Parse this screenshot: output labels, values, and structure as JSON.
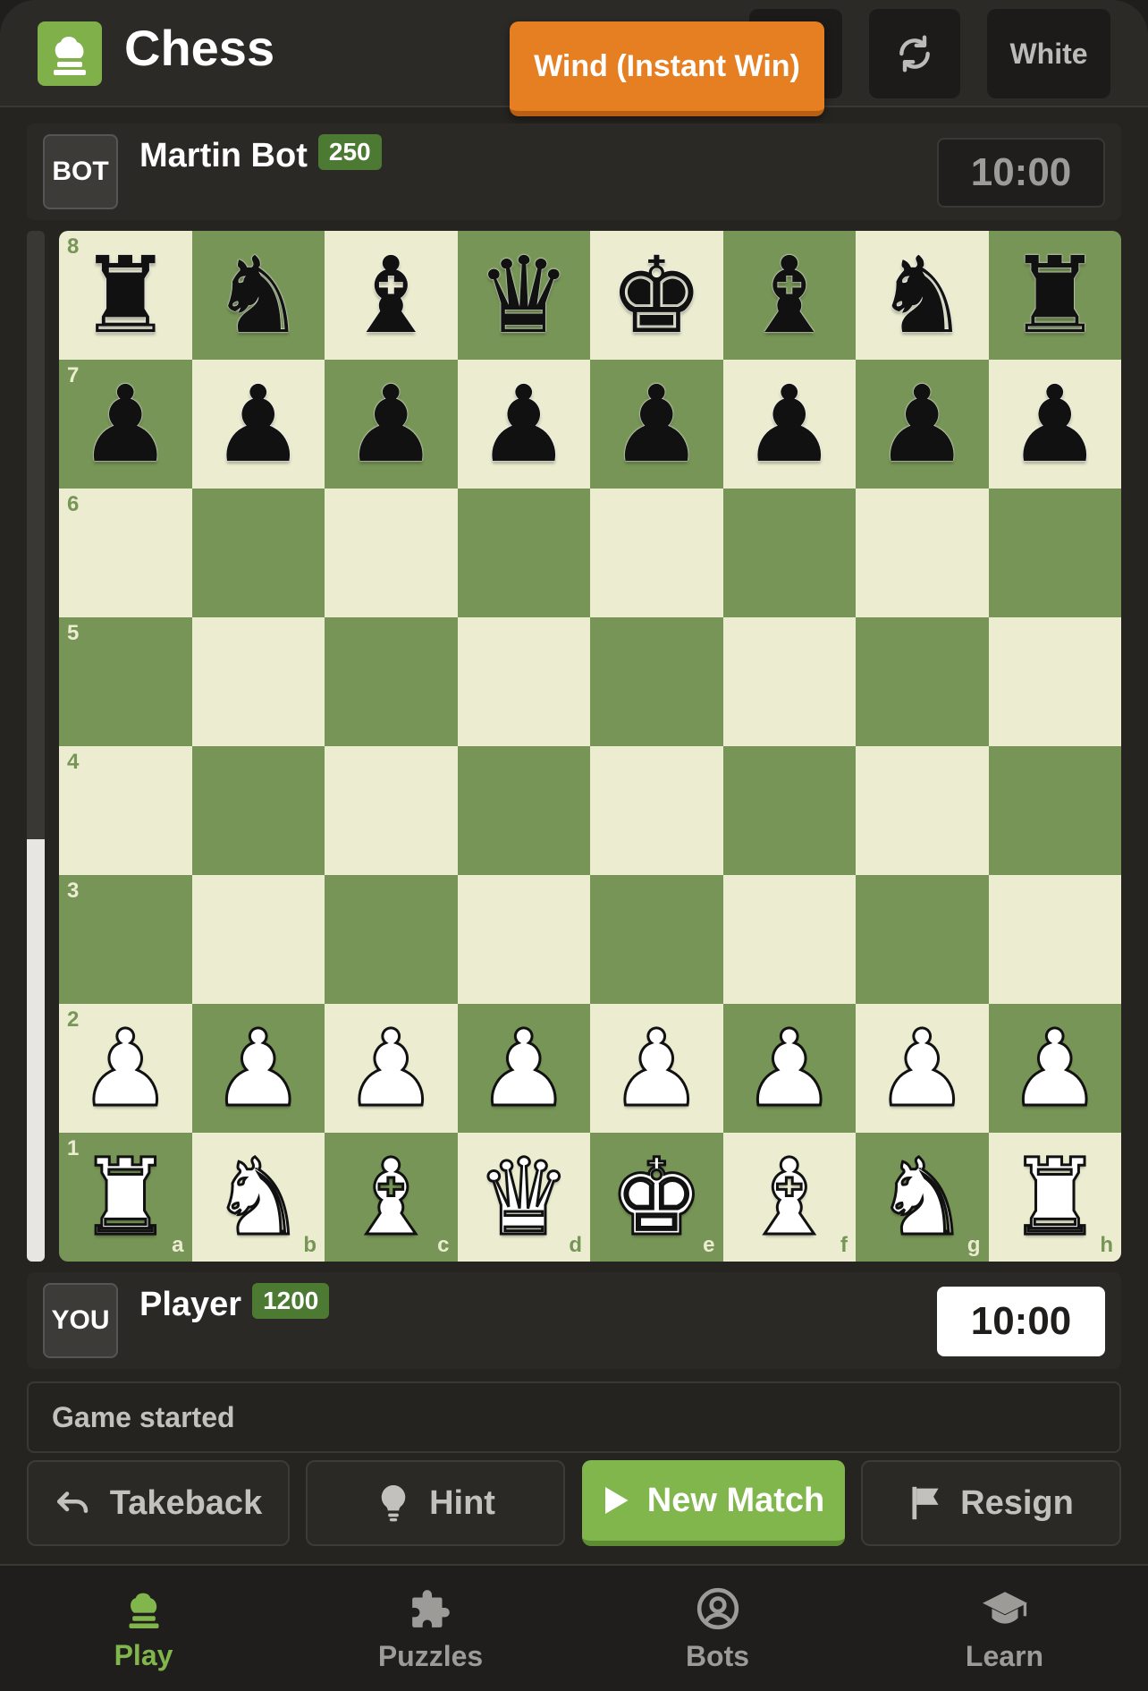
{
  "header": {
    "title": "Chess",
    "wind_button": "Wind (Instant Win)",
    "color_button": "White"
  },
  "opponent": {
    "avatar": "BOT",
    "name": "Martin Bot",
    "rating": "250",
    "clock": "10:00"
  },
  "player": {
    "avatar": "YOU",
    "name": "Player",
    "rating": "1200",
    "clock": "10:00"
  },
  "evaluation_fraction_white": 0.41,
  "board": {
    "ranks": [
      "8",
      "7",
      "6",
      "5",
      "4",
      "3",
      "2",
      "1"
    ],
    "files": [
      "a",
      "b",
      "c",
      "d",
      "e",
      "f",
      "g",
      "h"
    ],
    "position": [
      [
        "r",
        "n",
        "b",
        "q",
        "k",
        "b",
        "n",
        "r"
      ],
      [
        "p",
        "p",
        "p",
        "p",
        "p",
        "p",
        "p",
        "p"
      ],
      [
        "",
        "",
        "",
        "",
        "",
        "",
        "",
        ""
      ],
      [
        "",
        "",
        "",
        "",
        "",
        "",
        "",
        ""
      ],
      [
        "",
        "",
        "",
        "",
        "",
        "",
        "",
        ""
      ],
      [
        "",
        "",
        "",
        "",
        "",
        "",
        "",
        ""
      ],
      [
        "P",
        "P",
        "P",
        "P",
        "P",
        "P",
        "P",
        "P"
      ],
      [
        "R",
        "N",
        "B",
        "Q",
        "K",
        "B",
        "N",
        "R"
      ]
    ],
    "light_color": "#ebecd0",
    "dark_color": "#779556"
  },
  "status": "Game started",
  "actions": {
    "takeback": "Takeback",
    "hint": "Hint",
    "new_match": "New Match",
    "resign": "Resign"
  },
  "nav": {
    "play": "Play",
    "puzzles": "Puzzles",
    "bots": "Bots",
    "learn": "Learn"
  },
  "colors": {
    "accent": "#81b64c",
    "wind": "#e67e22"
  }
}
